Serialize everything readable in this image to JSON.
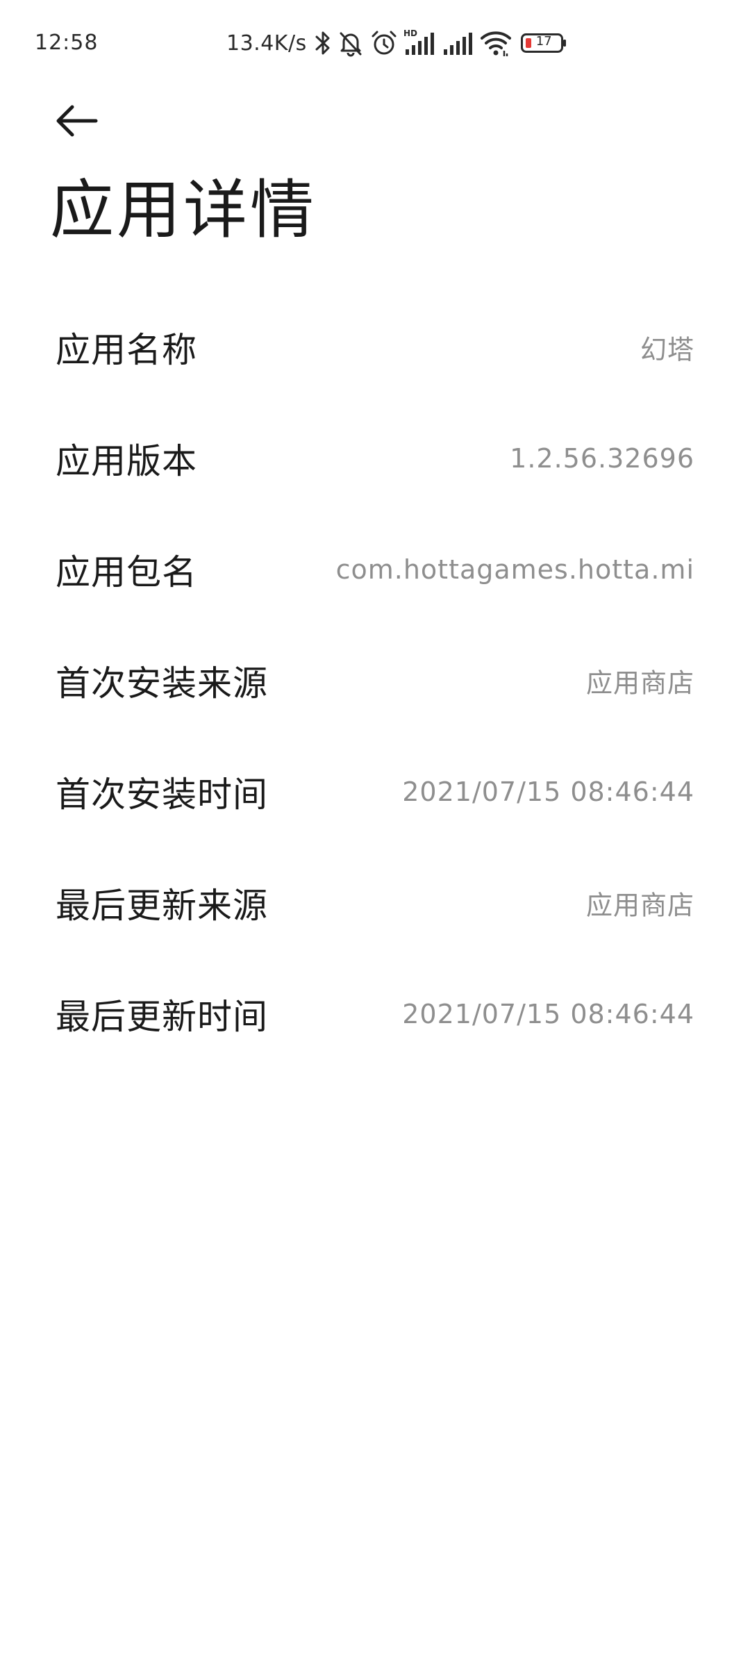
{
  "status_bar": {
    "time": "12:58",
    "net_speed": "13.4K/s",
    "signal_hd_label": "HD",
    "battery_level": "17",
    "icons": [
      "bluetooth-icon",
      "mute-bell-icon",
      "alarm-icon",
      "signal-hd-icon",
      "signal-icon",
      "wifi-icon",
      "battery-icon"
    ],
    "battery_low_color": "#e53935"
  },
  "header": {
    "back_icon": "arrow-left-icon",
    "title": "应用详情"
  },
  "details": [
    {
      "label": "应用名称",
      "value": "幻塔"
    },
    {
      "label": "应用版本",
      "value": "1.2.56.32696"
    },
    {
      "label": "应用包名",
      "value": "com.hottagames.hotta.mi"
    },
    {
      "label": "首次安装来源",
      "value": "应用商店"
    },
    {
      "label": "首次安装时间",
      "value": "2021/07/15 08:46:44"
    },
    {
      "label": "最后更新来源",
      "value": "应用商店"
    },
    {
      "label": "最后更新时间",
      "value": "2021/07/15 08:46:44"
    }
  ]
}
